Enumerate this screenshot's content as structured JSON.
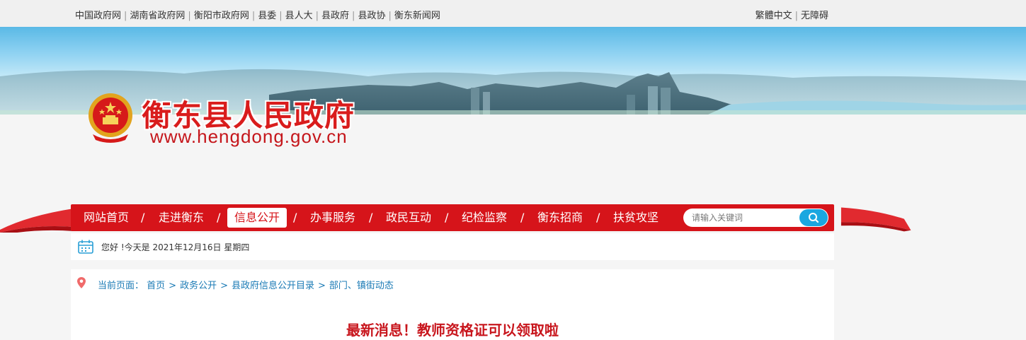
{
  "topbar": {
    "links": [
      "中国政府网",
      "湖南省政府网",
      "衡阳市政府网",
      "县委",
      "县人大",
      "县政府",
      "县政协",
      "衡东新闻网"
    ],
    "right_links": [
      "繁體中文",
      "无障碍"
    ]
  },
  "header": {
    "site_name": "衡东县人民政府",
    "site_url": "www.hengdong.gov.cn"
  },
  "nav": {
    "items": [
      "网站首页",
      "走进衡东",
      "信息公开",
      "办事服务",
      "政民互动",
      "纪检监察",
      "衡东招商",
      "扶贫攻坚"
    ],
    "active_index": 2,
    "separator": "/",
    "search_placeholder": "请输入关键词"
  },
  "datebar": {
    "text": "您好 !今天是 2021年12月16日  星期四"
  },
  "breadcrumb": {
    "label": "当前页面：",
    "items": [
      "首页",
      "政务公开",
      "县政府信息公开目录",
      "部门、镇街动态"
    ],
    "separator": ">"
  },
  "article": {
    "title": "最新消息！教师资格证可以领取啦"
  },
  "colors": {
    "brand_red": "#d6141a",
    "link_blue": "#1a7ab5",
    "search_blue": "#1aa7e0"
  }
}
